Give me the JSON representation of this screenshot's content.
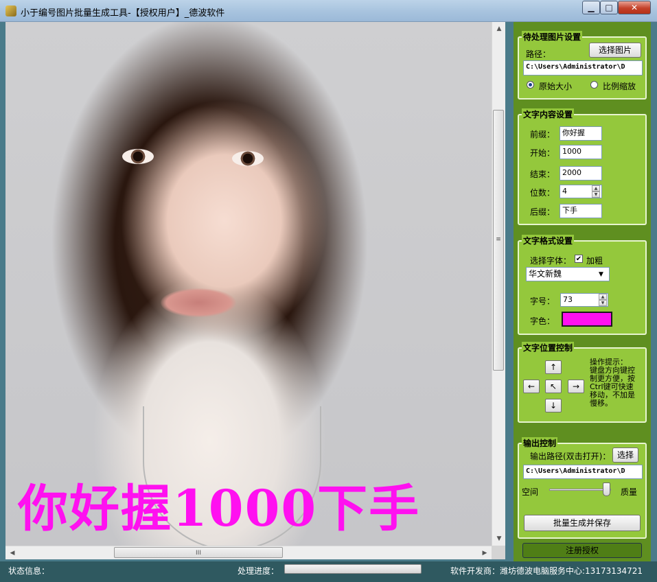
{
  "window": {
    "title": "小于编号图片批量生成工具-【授权用户】_德波软件",
    "min_label": "▁",
    "max_label": "□",
    "close_label": "✕"
  },
  "preview": {
    "overlay_text": "你好握1000下手",
    "overlay_color": "#ff10f0",
    "hscroll_grip": "III",
    "vscroll_grip": "≡"
  },
  "image_settings": {
    "title": "待处理图片设置",
    "path_label": "路径：",
    "choose_button": "选择图片",
    "path_value": "C:\\Users\\Administrator\\D",
    "radio_original": "原始大小",
    "radio_scale": "比例缩放",
    "selected": "原始大小"
  },
  "text_content": {
    "title": "文字内容设置",
    "prefix_label": "前缀：",
    "prefix_value": "你好握",
    "start_label": "开始：",
    "start_value": "1000",
    "end_label": "结束：",
    "end_value": "2000",
    "digits_label": "位数：",
    "digits_value": "4",
    "suffix_label": "后缀：",
    "suffix_value": "下手"
  },
  "text_format": {
    "title": "文字格式设置",
    "font_label": "选择字体：",
    "bold_label": "加粗",
    "bold_checked": true,
    "font_value": "华文新魏",
    "size_label": "字号：",
    "size_value": "73",
    "color_label": "字色：",
    "color_value": "#ff10f0"
  },
  "position_control": {
    "title": "文字位置控制",
    "up": "↑",
    "left": "←",
    "center": "↖",
    "right": "→",
    "down": "↓",
    "hint_lines": [
      "操作提示：",
      "键盘方向键控",
      "制更方便，按",
      "Ctrl键可快速",
      "移动，不加是",
      "慢移。"
    ]
  },
  "output_control": {
    "title": "输出控制",
    "path_label": "输出路径(双击打开)：",
    "choose_button": "选择",
    "path_value": "C:\\Users\\Administrator\\D",
    "space_label": "空间",
    "quality_label": "质量",
    "quality_level": 0.93,
    "generate_button": "批量生成并保存"
  },
  "register_button": "注册授权",
  "status": {
    "status_label": "状态信息：",
    "progress_label": "处理进度：",
    "progress_value": 0,
    "developer": "软件开发商：潍坊德波电脑服务中心:13173134721"
  }
}
